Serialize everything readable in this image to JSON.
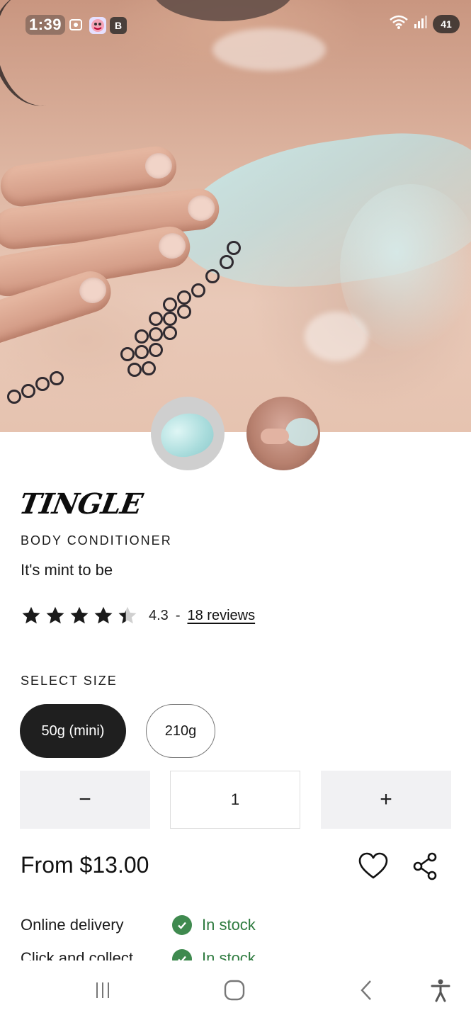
{
  "status_bar": {
    "time": "1:39",
    "battery": "41"
  },
  "product": {
    "brand": "TINGLE",
    "category": "BODY CONDITIONER",
    "tagline": "It's mint to be",
    "rating": {
      "value": "4.3",
      "stars": 4.3,
      "separator": "-",
      "reviews_label": "18 reviews"
    }
  },
  "size_selector": {
    "label": "SELECT SIZE",
    "options": [
      "50g (mini)",
      "210g"
    ],
    "selected": "50g (mini)"
  },
  "quantity": {
    "minus": "−",
    "value": "1",
    "plus": "+"
  },
  "price": "From $13.00",
  "availability": [
    {
      "label": "Online delivery",
      "status": "In stock"
    },
    {
      "label": "Click and collect",
      "status": "In stock"
    }
  ],
  "icons": {
    "status": [
      "screenshot-icon",
      "app-icon",
      "b-icon",
      "wifi-icon",
      "signal-icon",
      "battery-icon"
    ],
    "actions": [
      "heart-icon",
      "share-icon"
    ],
    "nav": [
      "recent-apps-icon",
      "home-icon",
      "back-icon",
      "accessibility-icon"
    ]
  },
  "colors": {
    "in_stock": "#2d7a3e",
    "selected_size": "#1f1f1f",
    "qty_button_bg": "#f1f1f3"
  }
}
